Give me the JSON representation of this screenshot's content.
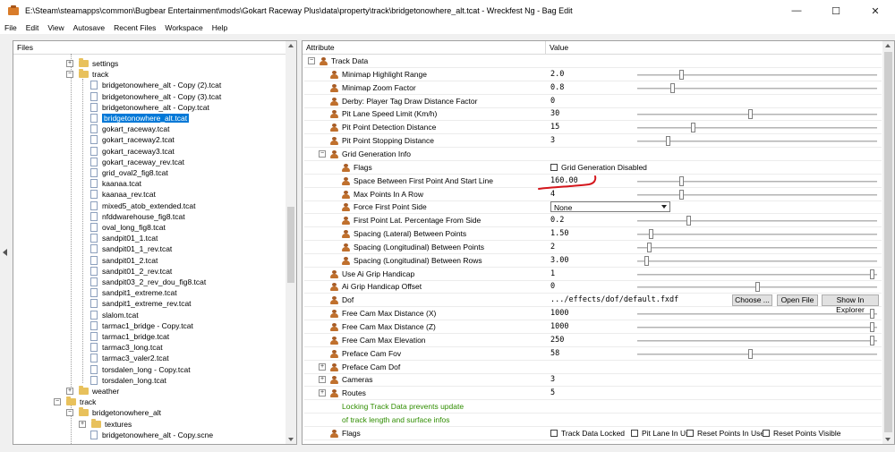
{
  "window": {
    "title": "E:\\Steam\\steamapps\\common\\Bugbear Entertainment\\mods\\Gokart Raceway Plus\\data\\property\\track\\bridgetonowhere_alt.tcat - Wreckfest Ng - Bag Edit",
    "minimize": "—",
    "maximize": "☐",
    "close": "✕"
  },
  "menu": [
    "File",
    "Edit",
    "View",
    "Autosave",
    "Recent Files",
    "Workspace",
    "Help"
  ],
  "files_panel": {
    "header": "Files",
    "items": [
      {
        "label": "settings",
        "kind": "folder",
        "expander": "+"
      },
      {
        "label": "track",
        "kind": "folder",
        "expander": "−"
      },
      {
        "label": "bridgetonowhere_alt - Copy (2).tcat",
        "kind": "file"
      },
      {
        "label": "bridgetonowhere_alt - Copy (3).tcat",
        "kind": "file"
      },
      {
        "label": "bridgetonowhere_alt - Copy.tcat",
        "kind": "file"
      },
      {
        "label": "bridgetonowhere_alt.tcat",
        "kind": "file",
        "selected": true
      },
      {
        "label": "gokart_raceway.tcat",
        "kind": "file"
      },
      {
        "label": "gokart_raceway2.tcat",
        "kind": "file"
      },
      {
        "label": "gokart_raceway3.tcat",
        "kind": "file"
      },
      {
        "label": "gokart_raceway_rev.tcat",
        "kind": "file"
      },
      {
        "label": "grid_oval2_fig8.tcat",
        "kind": "file"
      },
      {
        "label": "kaanaa.tcat",
        "kind": "file"
      },
      {
        "label": "kaanaa_rev.tcat",
        "kind": "file"
      },
      {
        "label": "mixed5_atob_extended.tcat",
        "kind": "file"
      },
      {
        "label": "nfddwarehouse_fig8.tcat",
        "kind": "file"
      },
      {
        "label": "oval_long_fig8.tcat",
        "kind": "file"
      },
      {
        "label": "sandpit01_1.tcat",
        "kind": "file"
      },
      {
        "label": "sandpit01_1_rev.tcat",
        "kind": "file"
      },
      {
        "label": "sandpit01_2.tcat",
        "kind": "file"
      },
      {
        "label": "sandpit01_2_rev.tcat",
        "kind": "file"
      },
      {
        "label": "sandpit03_2_rev_dou_fig8.tcat",
        "kind": "file"
      },
      {
        "label": "sandpit1_extreme.tcat",
        "kind": "file"
      },
      {
        "label": "sandpit1_extreme_rev.tcat",
        "kind": "file"
      },
      {
        "label": "slalom.tcat",
        "kind": "file"
      },
      {
        "label": "tarmac1_bridge - Copy.tcat",
        "kind": "file"
      },
      {
        "label": "tarmac1_bridge.tcat",
        "kind": "file"
      },
      {
        "label": "tarmac3_long.tcat",
        "kind": "file"
      },
      {
        "label": "tarmac3_valer2.tcat",
        "kind": "file"
      },
      {
        "label": "torsdalen_long - Copy.tcat",
        "kind": "file"
      },
      {
        "label": "torsdalen_long.tcat",
        "kind": "file"
      },
      {
        "label": "weather",
        "kind": "folder",
        "expander": "+"
      },
      {
        "label": "track",
        "kind": "folder",
        "expander": "−"
      },
      {
        "label": "bridgetonowhere_alt",
        "kind": "folder",
        "expander": "−"
      },
      {
        "label": "textures",
        "kind": "folder",
        "expander": "+"
      },
      {
        "label": "bridgetonowhere_alt - Copy.scne",
        "kind": "file"
      }
    ]
  },
  "attr_panel": {
    "col_attribute": "Attribute",
    "col_value": "Value",
    "rows": [
      {
        "name": "Track Data",
        "expander": "−",
        "level": 0
      },
      {
        "name": "Minimap Highlight Range",
        "value": "2.0",
        "slider": 0.18,
        "level": 1
      },
      {
        "name": "Minimap Zoom Factor",
        "value": "0.8",
        "slider": 0.14,
        "level": 1
      },
      {
        "name": "Derby: Player Tag Draw Distance Factor",
        "value": "0",
        "level": 1
      },
      {
        "name": "Pit Lane Speed Limit (Km/h)",
        "value": "30",
        "slider": 0.47,
        "level": 1
      },
      {
        "name": "Pit Point Detection Distance",
        "value": "15",
        "slider": 0.23,
        "level": 1
      },
      {
        "name": "Pit Point Stopping Distance",
        "value": "3",
        "slider": 0.12,
        "level": 1
      },
      {
        "name": "Grid Generation Info",
        "expander": "−",
        "level": 1
      },
      {
        "name": "Flags",
        "checkbox": "Grid Generation Disabled",
        "level": 2
      },
      {
        "name": "Space Between First Point And Start Line",
        "value": "160.00",
        "slider": 0.18,
        "level": 2
      },
      {
        "name": "Max Points In A Row",
        "value": "4",
        "slider": 0.18,
        "level": 2
      },
      {
        "name": "Force First Point Side",
        "value": "None",
        "dropdown": true,
        "level": 2
      },
      {
        "name": "First Point Lat. Percentage From Side",
        "value": "0.2",
        "slider": 0.21,
        "level": 2
      },
      {
        "name": "Spacing (Lateral) Between Points",
        "value": "1.50",
        "slider": 0.05,
        "level": 2
      },
      {
        "name": "Spacing (Longitudinal) Between Points",
        "value": "2",
        "slider": 0.04,
        "level": 2
      },
      {
        "name": "Spacing (Longitudinal) Between Rows",
        "value": "3.00",
        "slider": 0.03,
        "level": 2
      },
      {
        "name": "Use Ai Grip Handicap",
        "value": "1",
        "slider": 0.99,
        "level": 1
      },
      {
        "name": "Ai Grip Handicap Offset",
        "value": "0",
        "slider": 0.5,
        "level": 1
      },
      {
        "name": "Dof",
        "value": ".../effects/dof/default.fxdf",
        "buttons": [
          "Choose ...",
          "Open File",
          "Show In Explorer"
        ],
        "level": 1
      },
      {
        "name": "Free Cam Max Distance (X)",
        "value": "1000",
        "slider": 0.99,
        "level": 1
      },
      {
        "name": "Free Cam Max Distance (Z)",
        "value": "1000",
        "slider": 0.99,
        "level": 1
      },
      {
        "name": "Free Cam Max Elevation",
        "value": "250",
        "slider": 0.99,
        "level": 1
      },
      {
        "name": "Preface Cam Fov",
        "value": "58",
        "slider": 0.47,
        "level": 1
      },
      {
        "name": "Preface Cam Dof",
        "expander": "+",
        "level": 1
      },
      {
        "name": "Cameras",
        "value": "3",
        "expander": "+",
        "level": 1
      },
      {
        "name": "Routes",
        "value": "5",
        "expander": "+",
        "level": 1
      },
      {
        "name": "Locking Track Data prevents update",
        "green": true,
        "level": 1
      },
      {
        "name": "of track length and surface infos",
        "green": true,
        "level": 1
      },
      {
        "name": "Flags",
        "checkboxes": [
          "Track Data Locked",
          "Pit Lane In Use",
          "Reset Points In Use",
          "Reset Points Visible"
        ],
        "level": 1
      }
    ]
  },
  "colors": {
    "selection": "#0078d7",
    "annotation": "#d4161c",
    "green_text": "#2f8d00"
  }
}
